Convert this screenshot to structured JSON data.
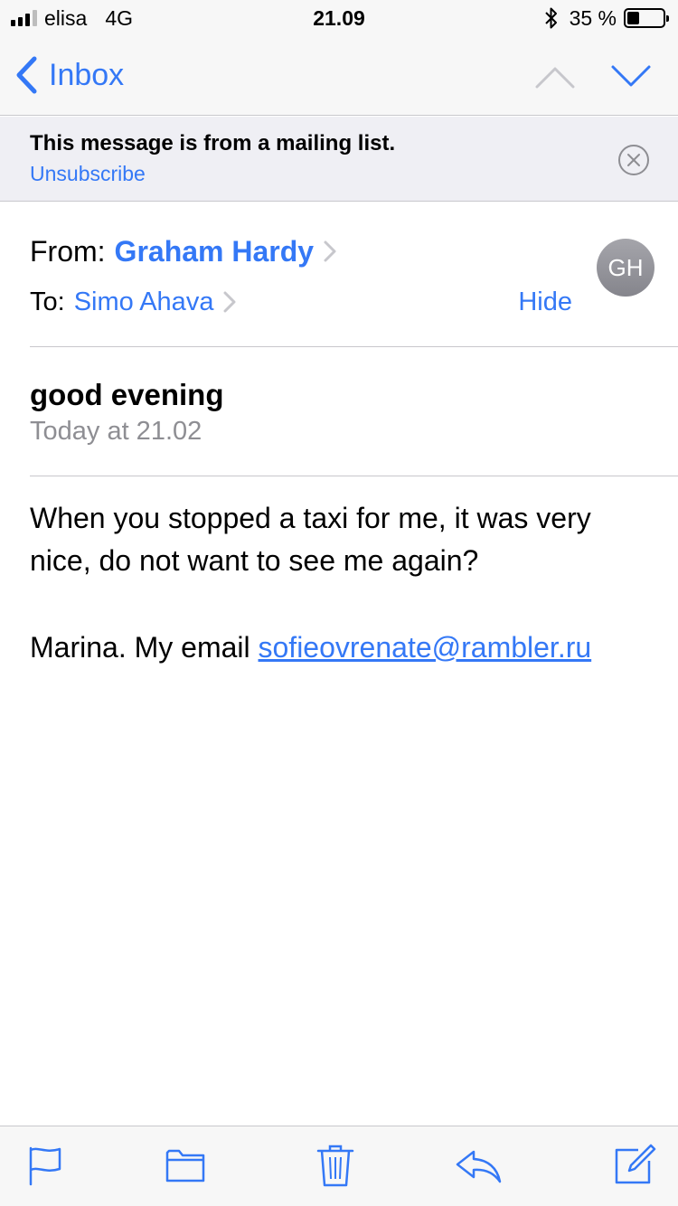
{
  "status_bar": {
    "carrier": "elisa",
    "network": "4G",
    "time": "21.09",
    "battery_percent": "35 %",
    "battery_level": 0.35,
    "signal_bars": 3
  },
  "nav": {
    "back_label": "Inbox"
  },
  "banner": {
    "title": "This message is from a mailing list.",
    "link": "Unsubscribe"
  },
  "header": {
    "from_label": "From:",
    "from_name": "Graham Hardy",
    "to_label": "To:",
    "to_name": "Simo Ahava",
    "hide_label": "Hide",
    "avatar_initials": "GH"
  },
  "message": {
    "subject": "good evening",
    "date": "Today at 21.02",
    "body_line": "When you stopped a taxi for me, it was very nice, do not want to see me again?",
    "signature_prefix": "Marina. My email ",
    "email": "sofieovrenate@rambler.ru"
  },
  "colors": {
    "accent": "#3478f6",
    "secondary_text": "#8e8e93",
    "bar_background": "#f7f7f7"
  },
  "toolbar": {
    "icons": [
      "flag-icon",
      "folder-icon",
      "trash-icon",
      "reply-icon",
      "compose-icon"
    ]
  }
}
